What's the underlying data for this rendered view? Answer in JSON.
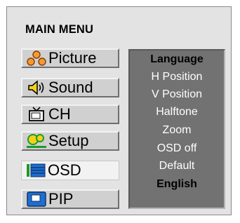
{
  "title": "MAIN MENU",
  "menu": {
    "items": [
      {
        "label": "Picture",
        "icon": "people-icon"
      },
      {
        "label": "Sound",
        "icon": "speaker-icon"
      },
      {
        "label": "CH",
        "icon": "tv-icon"
      },
      {
        "label": "Setup",
        "icon": "setup-icon"
      },
      {
        "label": "OSD",
        "icon": "osd-icon",
        "selected": true
      },
      {
        "label": "PIP",
        "icon": "pip-icon"
      }
    ]
  },
  "submenu": {
    "items": [
      "Language",
      "H Position",
      "V Position",
      "Halftone",
      "Zoom",
      "OSD off",
      "Default",
      "English"
    ]
  },
  "colors": {
    "frame": "#e3e3e3",
    "panel": "#727272",
    "icon_orange": "#e8761c",
    "icon_yellow": "#f2d21a",
    "icon_blue": "#1e6fd0",
    "icon_green": "#1f9a2a"
  }
}
